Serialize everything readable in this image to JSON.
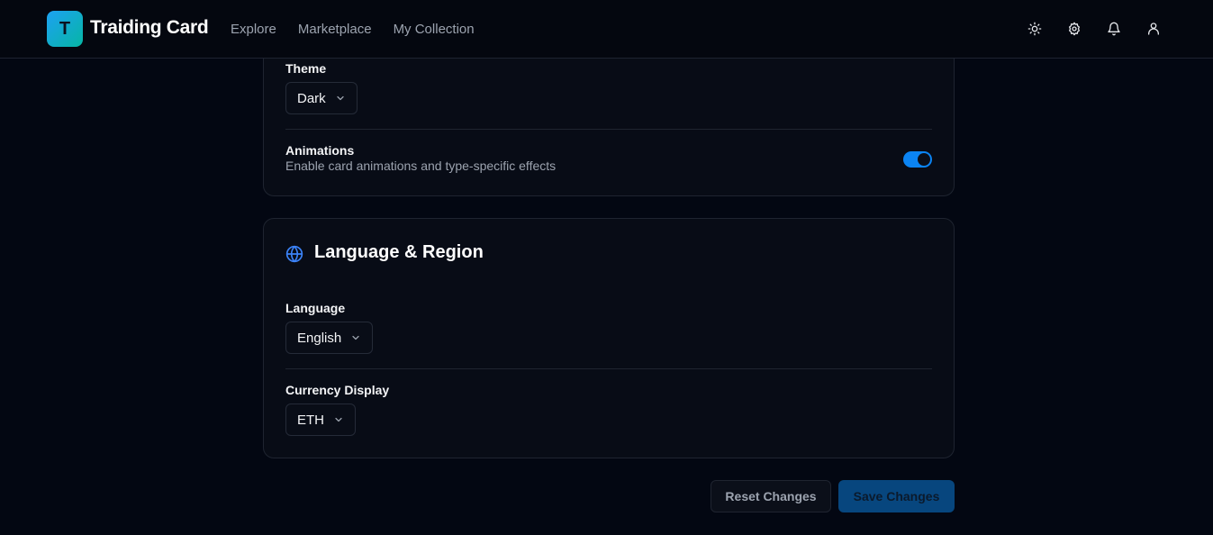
{
  "app": {
    "logo_letter": "T",
    "title": "Traiding Card"
  },
  "nav": {
    "items": [
      {
        "label": "Explore"
      },
      {
        "label": "Marketplace"
      },
      {
        "label": "My Collection"
      }
    ]
  },
  "header_icons": [
    "sun-icon",
    "gear-icon",
    "bell-icon",
    "user-icon"
  ],
  "appearance": {
    "theme_label": "Theme",
    "theme_value": "Dark",
    "animations_label": "Animations",
    "animations_description": "Enable card animations and type-specific effects",
    "animations_enabled": true
  },
  "language_region": {
    "title": "Language & Region",
    "icon": "globe-icon",
    "language_label": "Language",
    "language_value": "English",
    "currency_label": "Currency Display",
    "currency_value": "ETH"
  },
  "actions": {
    "reset_label": "Reset Changes",
    "save_label": "Save Changes"
  },
  "colors": {
    "accent": "#0b84f3",
    "background": "#030712",
    "card": "#080c16",
    "save_button": "#07467e"
  }
}
